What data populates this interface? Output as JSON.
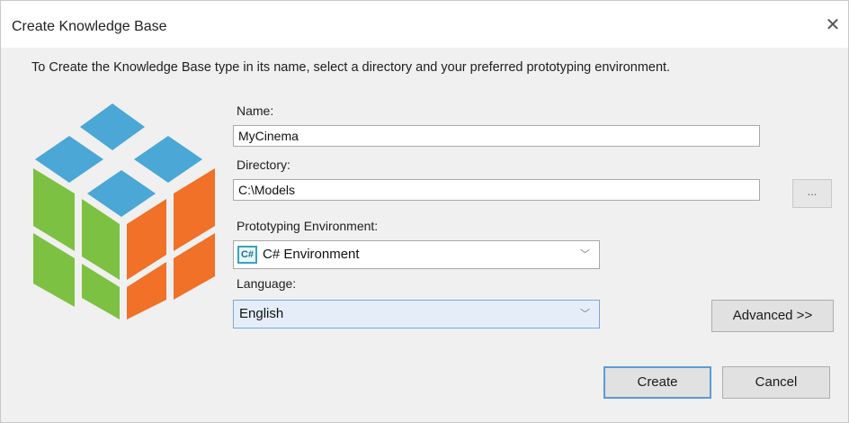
{
  "window": {
    "title": "Create Knowledge Base",
    "close_glyph": "✕"
  },
  "instructions": "To Create the Knowledge Base type in its name, select a directory and your preferred prototyping environment.",
  "logo": {
    "icon": "rubiks-cube-logo",
    "colors": {
      "top": "#4aa7d6",
      "left": "#7dc142",
      "right": "#f07127"
    }
  },
  "form": {
    "name_label": "Name:",
    "name_value": "MyCinema",
    "directory_label": "Directory:",
    "directory_value": "C:\\Models",
    "browse_label": "...",
    "env_label": "Prototyping Environment:",
    "env_badge": "C#",
    "env_value": "C# Environment",
    "language_label": "Language:",
    "language_value": "English",
    "dropdown_glyph": "﹀"
  },
  "buttons": {
    "advanced": "Advanced >>",
    "create": "Create",
    "cancel": "Cancel"
  }
}
